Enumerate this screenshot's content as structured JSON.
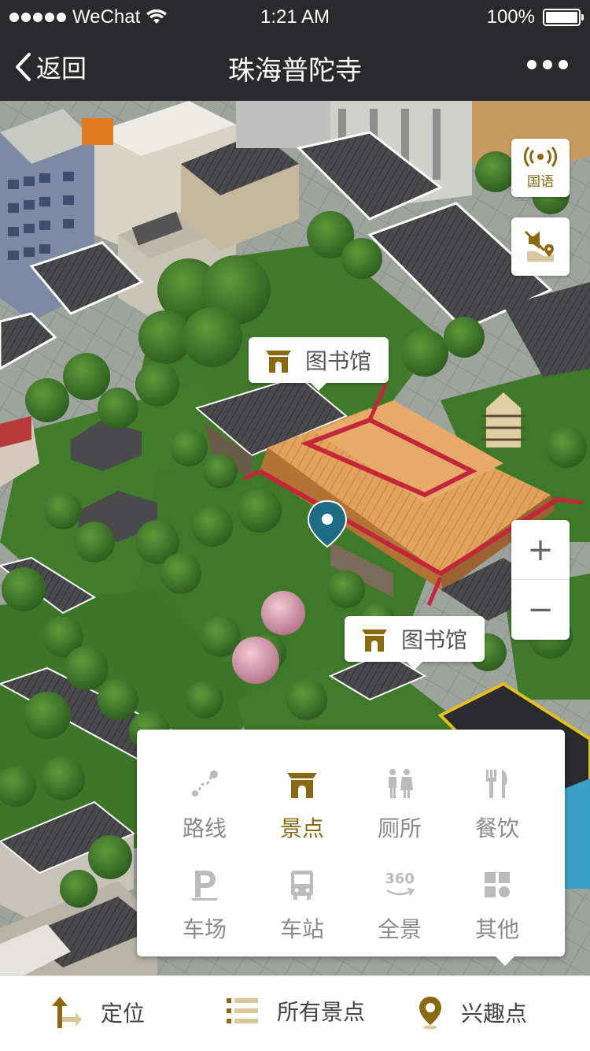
{
  "status_bar": {
    "carrier": "WeChat",
    "time": "1:21 AM",
    "battery": "100%"
  },
  "nav": {
    "back_label": "返回",
    "title": "珠海普陀寺"
  },
  "map": {
    "labels": [
      {
        "text": "图书馆"
      },
      {
        "text": "图书馆"
      }
    ],
    "side_buttons": {
      "audio_label": "国语"
    },
    "zoom": {
      "in": "+",
      "out": "−"
    }
  },
  "categories": [
    {
      "label": "路线",
      "icon": "route-icon",
      "active": false
    },
    {
      "label": "景点",
      "icon": "temple-icon",
      "active": true
    },
    {
      "label": "厕所",
      "icon": "toilet-icon",
      "active": false
    },
    {
      "label": "餐饮",
      "icon": "dining-icon",
      "active": false
    },
    {
      "label": "车场",
      "icon": "parking-icon",
      "active": false
    },
    {
      "label": "车站",
      "icon": "bus-icon",
      "active": false
    },
    {
      "label": "全景",
      "icon": "panorama-360-icon",
      "active": false,
      "icon_text": "360"
    },
    {
      "label": "其他",
      "icon": "grid-icon",
      "active": false
    }
  ],
  "bottom_bar": {
    "locate": "定位",
    "all_spots": "所有景点",
    "poi": "兴趣点"
  },
  "colors": {
    "accent": "#8b6914",
    "bar": "#2a2a2c"
  }
}
